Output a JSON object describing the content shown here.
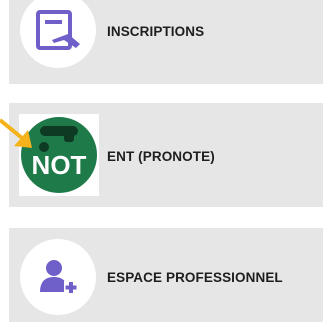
{
  "items": [
    {
      "label": "INSCRIPTIONS",
      "icon": "form-edit-icon"
    },
    {
      "label": "ENT (PRONOTE)",
      "icon": "pronote-logo",
      "logo_text": "NOT"
    },
    {
      "label": "ESPACE PROFESSIONNEL",
      "icon": "add-user-icon"
    }
  ],
  "colors": {
    "card_bg": "#e6e6e6",
    "icon_purple": "#6f5fc9",
    "pronote_green": "#1f7a4a",
    "arrow": "#f5b21b"
  }
}
